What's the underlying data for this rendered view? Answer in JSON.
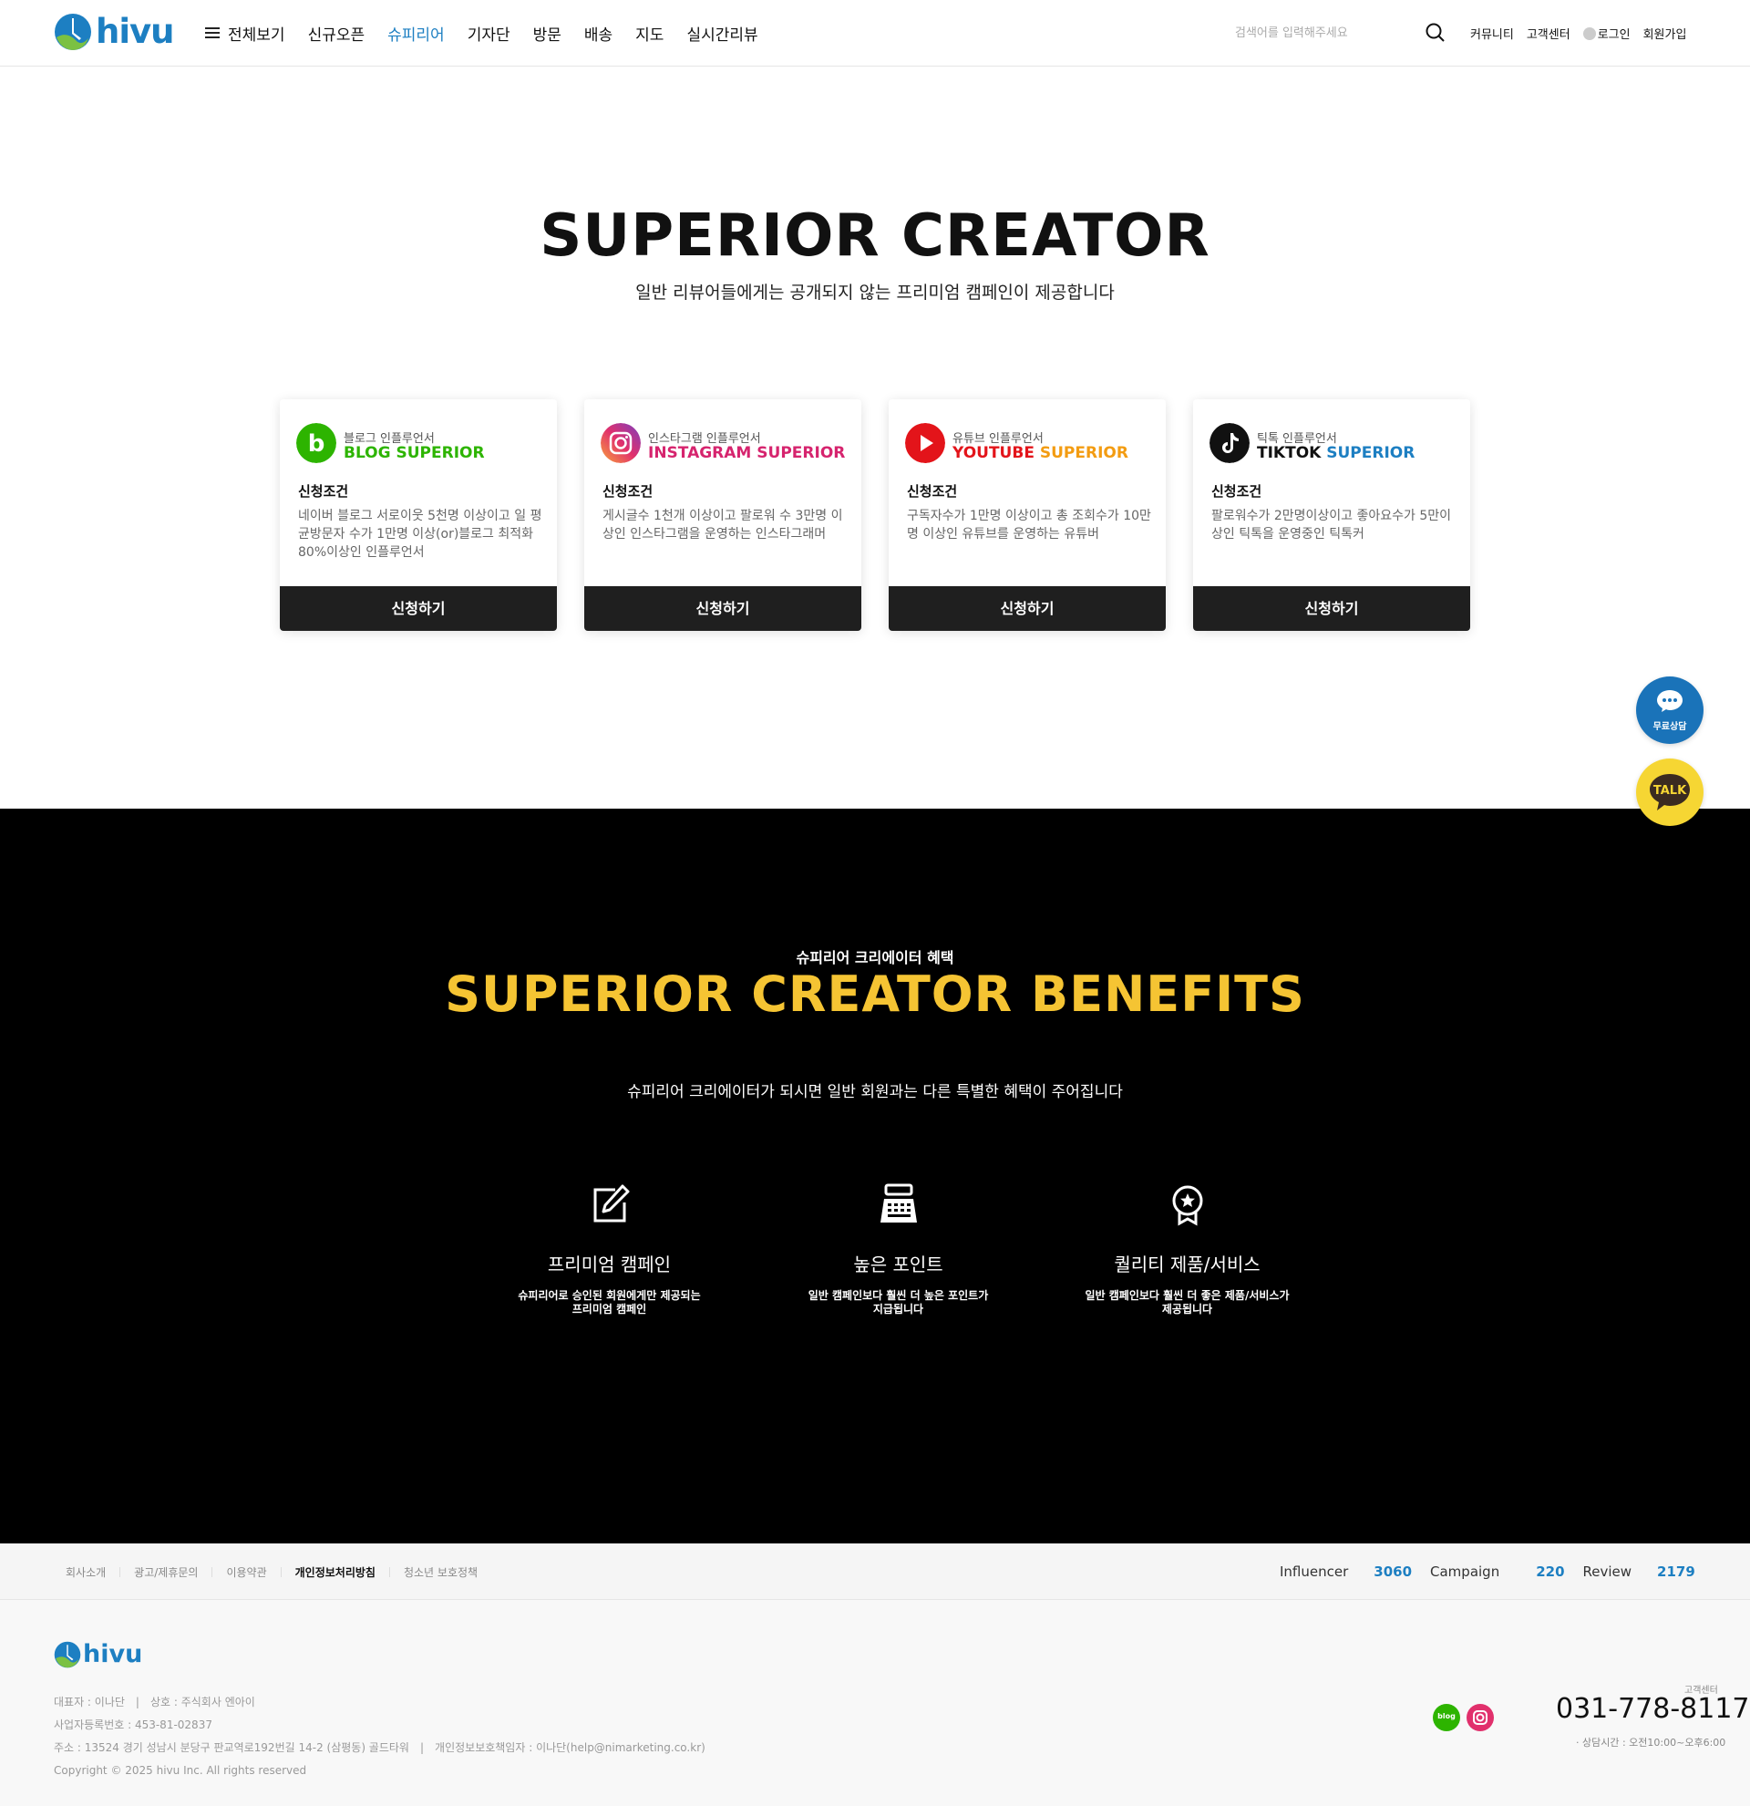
{
  "header": {
    "logo_text": "hivu",
    "nav": [
      {
        "label": "전체보기"
      },
      {
        "label": "신규오픈"
      },
      {
        "label": "슈피리어"
      },
      {
        "label": "기자단"
      },
      {
        "label": "방문"
      },
      {
        "label": "배송"
      },
      {
        "label": "지도"
      },
      {
        "label": "실시간리뷰"
      }
    ],
    "search_placeholder": "검색어를 입력해주세요",
    "util": {
      "community": "커뮤니티",
      "support": "고객센터",
      "login": "로그인",
      "signup": "회원가입"
    }
  },
  "hero": {
    "title": "SUPERIOR CREATOR",
    "subtitle": "일반 리뷰어들에게는 공개되지 않는 프리미엄 캠페인이 제공합니다"
  },
  "cards": [
    {
      "top": "블로그 인플루언서",
      "name_a": "BLOG",
      "name_b": " SUPERIOR",
      "cond": "신청조건",
      "desc": "네이버 블로그 서로이웃 5천명 이상이고 일 평균방문자 수가 1만명 이상(or)블로그 최적화 80%이상인 인플루언서",
      "button": "신청하기",
      "color": "#2db400"
    },
    {
      "top": "인스타그램 인플루언서",
      "name_a": "INSTAGRAM",
      "name_b": " SUPERIOR",
      "cond": "신청조건",
      "desc": "게시글수 1천개 이상이고 팔로워 수 3만명 이상인 인스타그램을 운영하는 인스타그래머",
      "button": "신청하기",
      "color": "#d6246e"
    },
    {
      "top": "유튜브 인플루언서",
      "name_a": "YOUTUBE",
      "name_b": " SUPERIOR",
      "cond": "신청조건",
      "desc": "구독자수가 1만명 이상이고 총 조회수가 10만명 이상인 유튜브를 운영하는 유튜버",
      "button": "신청하기",
      "color": "#e3141a"
    },
    {
      "top": "틱톡 인플루언서",
      "name_a": "TIKTOK",
      "name_b": " SUPERIOR",
      "cond": "신청조건",
      "desc": "팔로워수가 2만명이상이고 좋아요수가 5만이상인 틱톡을 운영중인 틱톡커",
      "button": "신청하기",
      "color": "#111111"
    }
  ],
  "floating": {
    "chat": "무료상담",
    "talk": "TALK"
  },
  "benefits_section": {
    "small": "슈피리어 크리에이터 혜택",
    "title": "SUPERIOR CREATOR BENEFITS",
    "subtitle": "슈피리어 크리에이터가 되시면 일반 회원과는 다른 특별한 혜택이 주어집니다",
    "items": [
      {
        "title": "프리미엄 캠페인",
        "desc1": "슈피리어로 승인된 회원에게만 제공되는",
        "desc2": "프리미엄 캠페인"
      },
      {
        "title": "높은 포인트",
        "desc1": "일반 캠페인보다 훨씬 더 높은 포인트가",
        "desc2": "지급됩니다"
      },
      {
        "title": "퀄리티 제품/서비스",
        "desc1": "일반 캠페인보다 훨씬 더 좋은 제품/서비스가",
        "desc2": "제공됩니다"
      }
    ]
  },
  "footer": {
    "links": [
      "회사소개",
      "광고/제휴문의",
      "이용약관",
      "개인정보처리방침",
      "청소년 보호정책"
    ],
    "stats": {
      "influencer_label": "Influencer",
      "influencer": "3060",
      "campaign_label": "Campaign",
      "campaign": "220",
      "review_label": "Review",
      "review": "2179"
    },
    "logo_text": "hivu",
    "ceo": "대표자 : 이나단",
    "company": "상호 : 주식회사 엔아이",
    "biz_no": "사업자등록번호 : 453-81-02837",
    "address": "주소 : 13524 경기 성남시 분당구 판교역로192번길 14-2 (삼평동) 골드타워",
    "privacy_officer": "개인정보보호책임자 : 이나단(help@nimarketing.co.kr)",
    "copyright": "Copyright © 2025 hivu Inc. All rights reserved",
    "cs_label": "고객센터",
    "cs_phone": "031-778-8117",
    "cs_hours": "· 상담시간 : 오전10:00~오후6:00",
    "sns_blog": "blog"
  },
  "colors": {
    "brand": "#1d7fc2",
    "accent_yellow": "#f5c433",
    "talk_yellow": "#f6d633"
  }
}
